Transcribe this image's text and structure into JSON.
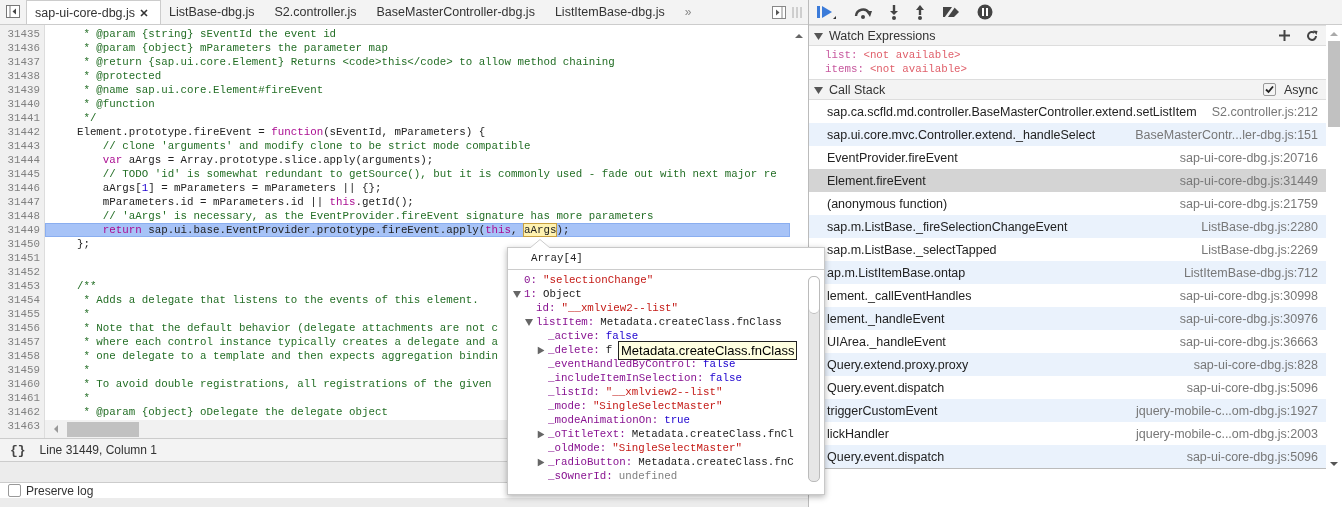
{
  "editor_tabs": {
    "tabs": [
      {
        "label": "sap-ui-core-dbg.js",
        "selected": true
      },
      {
        "label": "ListBase-dbg.js",
        "selected": false
      },
      {
        "label": "S2.controller.js",
        "selected": false
      },
      {
        "label": "BaseMasterController-dbg.js",
        "selected": false
      },
      {
        "label": "ListItemBase-dbg.js",
        "selected": false
      }
    ],
    "more": "»"
  },
  "code_lines": [
    {
      "number": "31435",
      "current": false,
      "segments": [
        {
          "kind": "comment",
          "text": "     * @param {string} sEventId the event id"
        }
      ]
    },
    {
      "number": "31436",
      "current": false,
      "segments": [
        {
          "kind": "comment",
          "text": "     * @param {object} mParameters the parameter map"
        }
      ]
    },
    {
      "number": "31437",
      "current": false,
      "segments": [
        {
          "kind": "comment",
          "text": "     * @return {sap.ui.core.Element} Returns <code>this</code> to allow method chaining"
        }
      ]
    },
    {
      "number": "31438",
      "current": false,
      "segments": [
        {
          "kind": "comment",
          "text": "     * @protected"
        }
      ]
    },
    {
      "number": "31439",
      "current": false,
      "segments": [
        {
          "kind": "comment",
          "text": "     * @name sap.ui.core.Element#fireEvent"
        }
      ]
    },
    {
      "number": "31440",
      "current": false,
      "segments": [
        {
          "kind": "comment",
          "text": "     * @function"
        }
      ]
    },
    {
      "number": "31441",
      "current": false,
      "segments": [
        {
          "kind": "comment",
          "text": "     */"
        }
      ]
    },
    {
      "number": "31442",
      "current": false,
      "segments": [
        {
          "kind": "plain",
          "text": "    Element.prototype.fireEvent = "
        },
        {
          "kind": "keyword",
          "text": "function"
        },
        {
          "kind": "plain",
          "text": "(sEventId, mParameters) {"
        }
      ]
    },
    {
      "number": "31443",
      "current": false,
      "segments": [
        {
          "kind": "comment",
          "text": "        // clone 'arguments' and modify clone to be strict mode compatible"
        }
      ]
    },
    {
      "number": "31444",
      "current": false,
      "segments": [
        {
          "kind": "keyword",
          "text": "        var"
        },
        {
          "kind": "plain",
          "text": " aArgs = Array.prototype.slice.apply(arguments);"
        }
      ]
    },
    {
      "number": "31445",
      "current": false,
      "segments": [
        {
          "kind": "comment",
          "text": "        // TODO 'id' is somewhat redundant to getSource(), but it is commonly used - fade out with next major re"
        }
      ]
    },
    {
      "number": "31446",
      "current": false,
      "segments": [
        {
          "kind": "plain",
          "text": "        aArgs["
        },
        {
          "kind": "number",
          "text": "1"
        },
        {
          "kind": "plain",
          "text": "] = mParameters = mParameters || {};"
        }
      ]
    },
    {
      "number": "31447",
      "current": false,
      "segments": [
        {
          "kind": "plain",
          "text": "        mParameters.id = mParameters.id || "
        },
        {
          "kind": "keyword",
          "text": "this"
        },
        {
          "kind": "plain",
          "text": ".getId();"
        }
      ]
    },
    {
      "number": "31448",
      "current": false,
      "segments": [
        {
          "kind": "comment",
          "text": "        // 'aArgs' is necessary, as the EventProvider.fireEvent signature has more parameters"
        }
      ]
    },
    {
      "number": "31449",
      "current": true,
      "segments": [
        {
          "kind": "keyword",
          "text": "        return"
        },
        {
          "kind": "plain",
          "text": " sap.ui.base.EventProvider.prototype.fireEvent.apply("
        },
        {
          "kind": "keyword",
          "text": "this"
        },
        {
          "kind": "plain",
          "text": ", "
        },
        {
          "kind": "highlight",
          "text": "aArgs"
        },
        {
          "kind": "plain",
          "text": ");"
        }
      ]
    },
    {
      "number": "31450",
      "current": false,
      "segments": [
        {
          "kind": "plain",
          "text": "    };"
        }
      ]
    },
    {
      "number": "31451",
      "current": false
    },
    {
      "number": "31452",
      "current": false
    },
    {
      "number": "31453",
      "current": false,
      "segments": [
        {
          "kind": "comment",
          "text": "    /**"
        }
      ]
    },
    {
      "number": "31454",
      "current": false,
      "segments": [
        {
          "kind": "comment",
          "text": "     * Adds a delegate that listens to the events of this element."
        }
      ]
    },
    {
      "number": "31455",
      "current": false,
      "segments": [
        {
          "kind": "comment",
          "text": "     *"
        }
      ]
    },
    {
      "number": "31456",
      "current": false,
      "segments": [
        {
          "kind": "comment",
          "text": "     * Note that the default behavior (delegate attachments are not c"
        }
      ]
    },
    {
      "number": "31457",
      "current": false,
      "segments": [
        {
          "kind": "comment",
          "text": "     * where each control instance typically creates a delegate and a"
        }
      ]
    },
    {
      "number": "31458",
      "current": false,
      "segments": [
        {
          "kind": "comment",
          "text": "     * one delegate to a template and then expects aggregation bindin"
        }
      ]
    },
    {
      "number": "31459",
      "current": false,
      "segments": [
        {
          "kind": "comment",
          "text": "     *"
        }
      ]
    },
    {
      "number": "31460",
      "current": false,
      "segments": [
        {
          "kind": "comment",
          "text": "     * To avoid double registrations, all registrations of the given"
        }
      ]
    },
    {
      "number": "31461",
      "current": false,
      "segments": [
        {
          "kind": "comment",
          "text": "     *"
        }
      ]
    },
    {
      "number": "31462",
      "current": false,
      "segments": [
        {
          "kind": "comment",
          "text": "     * @param {object} oDelegate the delegate object"
        }
      ]
    },
    {
      "number": "31463",
      "current": false
    }
  ],
  "status_bar": {
    "format_button": "{}",
    "position": "Line 31449, Column 1"
  },
  "console_options": {
    "preserve_log": {
      "label": "Preserve log",
      "checked": false
    }
  },
  "watch_expressions": {
    "title": "Watch Expressions",
    "expanded": true,
    "items": [
      {
        "name": "list:",
        "value": "<not available>"
      },
      {
        "name": "items:",
        "value": "<not available>"
      }
    ]
  },
  "call_stack": {
    "title": "Call Stack",
    "expanded": true,
    "async": {
      "label": "Async",
      "checked": true
    },
    "frames": [
      {
        "function": "sap.ca.scfld.md.controller.BaseMasterController.extend.setListItem",
        "location": "S2.controller.js:212",
        "selected": false
      },
      {
        "function": "sap.ui.core.mvc.Controller.extend._handleSelect",
        "location": "BaseMasterContr...ler-dbg.js:151",
        "selected": false
      },
      {
        "function": "EventProvider.fireEvent",
        "location": "sap-ui-core-dbg.js:20716",
        "selected": false
      },
      {
        "function": "Element.fireEvent",
        "location": "sap-ui-core-dbg.js:31449",
        "selected": true
      },
      {
        "function": "(anonymous function)",
        "location": "sap-ui-core-dbg.js:21759",
        "selected": false
      },
      {
        "function": "sap.m.ListBase._fireSelectionChangeEvent",
        "location": "ListBase-dbg.js:2280",
        "selected": false
      },
      {
        "function": "sap.m.ListBase._selectTapped",
        "location": "ListBase-dbg.js:2269",
        "selected": false
      },
      {
        "function": "ap.m.ListItemBase.ontap",
        "location": "ListItemBase-dbg.js:712",
        "selected": false
      },
      {
        "function": "lement._callEventHandles",
        "location": "sap-ui-core-dbg.js:30998",
        "selected": false
      },
      {
        "function": "lement._handleEvent",
        "location": "sap-ui-core-dbg.js:30976",
        "selected": false
      },
      {
        "function": "UIArea._handleEvent",
        "location": "sap-ui-core-dbg.js:36663",
        "selected": false
      },
      {
        "function": "Query.extend.proxy.proxy",
        "location": "sap-ui-core-dbg.js:828",
        "selected": false
      },
      {
        "function": "Query.event.dispatch",
        "location": "sap-ui-core-dbg.js:5096",
        "selected": false
      },
      {
        "function": "triggerCustomEvent",
        "location": "jquery-mobile-c...om-dbg.js:1927",
        "selected": false
      },
      {
        "function": "lickHandler",
        "location": "jquery-mobile-c...om-dbg.js:2003",
        "selected": false
      },
      {
        "function": "Query.event.dispatch",
        "location": "sap-ui-core-dbg.js:5096",
        "selected": false
      }
    ]
  },
  "popover": {
    "title": "Array[4]",
    "tooltip": "Metadata.createClass.fnClass",
    "entries": [
      {
        "name": "0:",
        "value": "\"selectionChange\"",
        "kind": "string"
      },
      {
        "name": "1:",
        "value": "Object",
        "kind": "object",
        "expanded": true,
        "children": [
          {
            "name": "id:",
            "value": "\"__xmlview2--list\"",
            "kind": "string"
          },
          {
            "name": "listItem:",
            "value": "Metadata.createClass.fnClass",
            "kind": "object",
            "expanded": true,
            "children": [
              {
                "name": "_active:",
                "value": "false",
                "kind": "literal"
              },
              {
                "name": "_delete:",
                "value": "f",
                "kind": "object",
                "expanded": false
              },
              {
                "name": "_eventHandledByControl:",
                "value": "false",
                "kind": "literal"
              },
              {
                "name": "_includeItemInSelection:",
                "value": "false",
                "kind": "literal"
              },
              {
                "name": "_listId:",
                "value": "\"__xmlview2--list\"",
                "kind": "string"
              },
              {
                "name": "_mode:",
                "value": "\"SingleSelectMaster\"",
                "kind": "string"
              },
              {
                "name": "_modeAnimationOn:",
                "value": "true",
                "kind": "literal"
              },
              {
                "name": "_oTitleText:",
                "value": "Metadata.createClass.fnCl",
                "kind": "object",
                "expanded": false
              },
              {
                "name": "_oldMode:",
                "value": "\"SingleSelectMaster\"",
                "kind": "string"
              },
              {
                "name": "_radioButton:",
                "value": "Metadata.createClass.fnC",
                "kind": "object",
                "expanded": false
              },
              {
                "name": "_sOwnerId:",
                "value": "undefined",
                "kind": "undefined"
              }
            ]
          }
        ]
      }
    ]
  }
}
